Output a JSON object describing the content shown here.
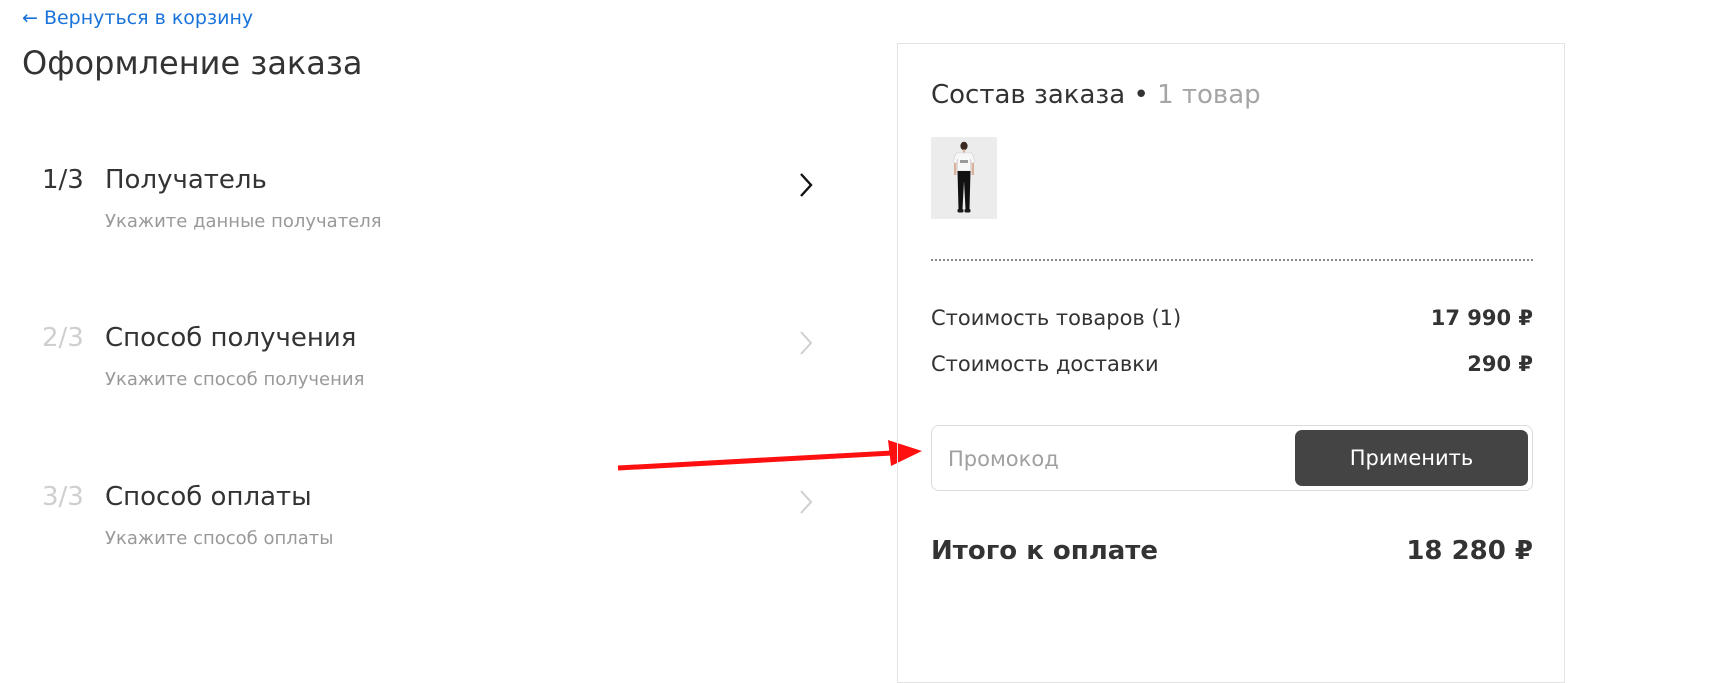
{
  "nav": {
    "back_link": "← Вернуться в корзину"
  },
  "page": {
    "title": "Оформление заказа"
  },
  "steps": [
    {
      "num": "1/3",
      "title": "Получатель",
      "subtitle": "Укажите данные получателя",
      "active": true
    },
    {
      "num": "2/3",
      "title": "Способ получения",
      "subtitle": "Укажите способ получения",
      "active": false
    },
    {
      "num": "3/3",
      "title": "Способ оплаты",
      "subtitle": "Укажите способ оплаты",
      "active": false
    }
  ],
  "summary": {
    "title": "Состав заказа",
    "separator": " • ",
    "count": "1 товар",
    "goods_label": "Стоимость товаров (1)",
    "goods_value": "17 990 ₽",
    "delivery_label": "Стоимость доставки",
    "delivery_value": "290 ₽",
    "promo_placeholder": "Промокод",
    "promo_button": "Применить",
    "total_label": "Итого к оплате",
    "total_value": "18 280 ₽"
  },
  "colors": {
    "link": "#1a73d9",
    "button": "#444444",
    "annotation_arrow": "#ff1010"
  }
}
